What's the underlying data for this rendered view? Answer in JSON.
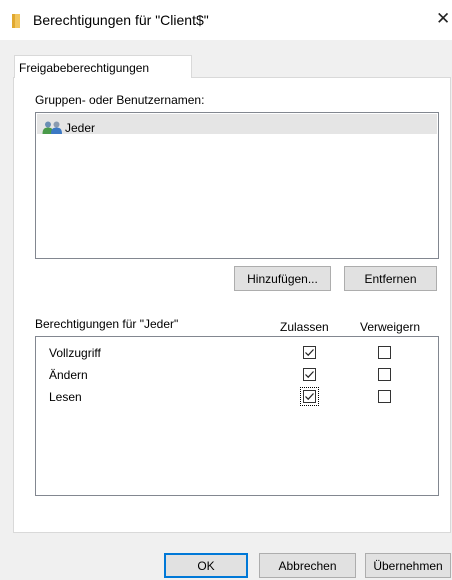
{
  "window": {
    "title": "Berechtigungen für \"Client$\"",
    "icon": "folder-icon",
    "close_icon": "✕"
  },
  "tabs": [
    {
      "label": "Freigabeberechtigungen",
      "active": true
    }
  ],
  "groups": {
    "label": "Gruppen- oder Benutzernamen:",
    "items": [
      {
        "name": "Jeder",
        "icon": "users-icon",
        "selected": true
      }
    ]
  },
  "buttons": {
    "add": "Hinzufügen...",
    "remove": "Entfernen",
    "ok": "OK",
    "cancel": "Abbrechen",
    "apply": "Übernehmen"
  },
  "permissions": {
    "label": "Berechtigungen für \"Jeder\"",
    "columns": {
      "allow": "Zulassen",
      "deny": "Verweigern"
    },
    "rows": [
      {
        "name": "Vollzugriff",
        "allow": true,
        "deny": false
      },
      {
        "name": "Ändern",
        "allow": true,
        "deny": false
      },
      {
        "name": "Lesen",
        "allow": true,
        "deny": false,
        "focused": true
      }
    ]
  },
  "colors": {
    "accent": "#0078d7",
    "selection": "#e5e5e5",
    "dialog_bg": "#f0f0f0"
  }
}
